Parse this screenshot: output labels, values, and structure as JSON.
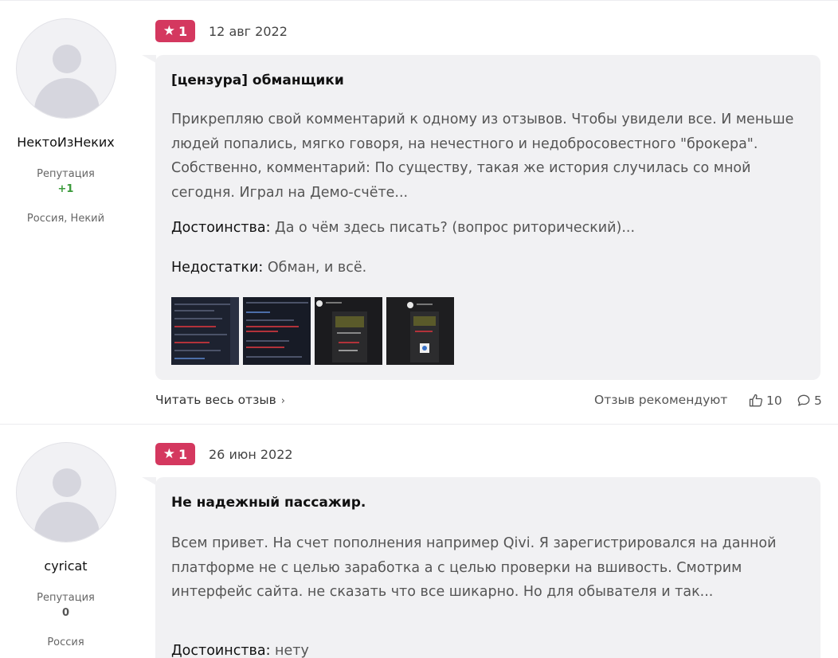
{
  "reviews": [
    {
      "author": "НектоИзНеких",
      "reputation_label": "Репутация",
      "reputation_value": "+1",
      "location": "Россия, Некий",
      "rating": "1",
      "date": "12 авг 2022",
      "title": "[цензура] обманщики",
      "text": "Прикрепляю свой комментарий к одному из отзывов. Чтобы увидели все. И меньше людей попались, мягко говоря, на нечестного и недобросовестного \"брокера\". Собственно, комментарий: По существу, такая же история случилась со мной сегодня. Играл на Демо-счёте...",
      "pros_label": "Достоинства:",
      "pros": "Да о чём здесь писать? (вопрос риторический)...",
      "cons_label": "Недостатки:",
      "cons": "Обман, и всё.",
      "read_more": "Читать весь отзыв",
      "recommend_label": "Отзыв рекомендуют",
      "likes": "10",
      "comments": "5"
    },
    {
      "author": "cyricat",
      "reputation_label": "Репутация",
      "reputation_value": "0",
      "location": "Россия",
      "rating": "1",
      "date": "26 июн 2022",
      "title": "Не надежный пассажир.",
      "text": "Всем привет. На счет пополнения например Qivi. Я зарегистрировался на данной платформе не с целью заработка а с целью проверки на вшивость. Смотрим интерфейс сайта. не сказать что все шикарно. Но для обывателя и так...",
      "pros_label": "Достоинства:",
      "pros": "нету"
    }
  ],
  "colors": {
    "rating_badge": "#d4385f",
    "bubble_bg": "#f1f1f3",
    "reputation_positive": "#3a9a3a"
  },
  "icons": [
    "star-icon",
    "chevron-right-icon",
    "thumbs-up-icon",
    "comment-icon",
    "avatar-placeholder-icon"
  ]
}
